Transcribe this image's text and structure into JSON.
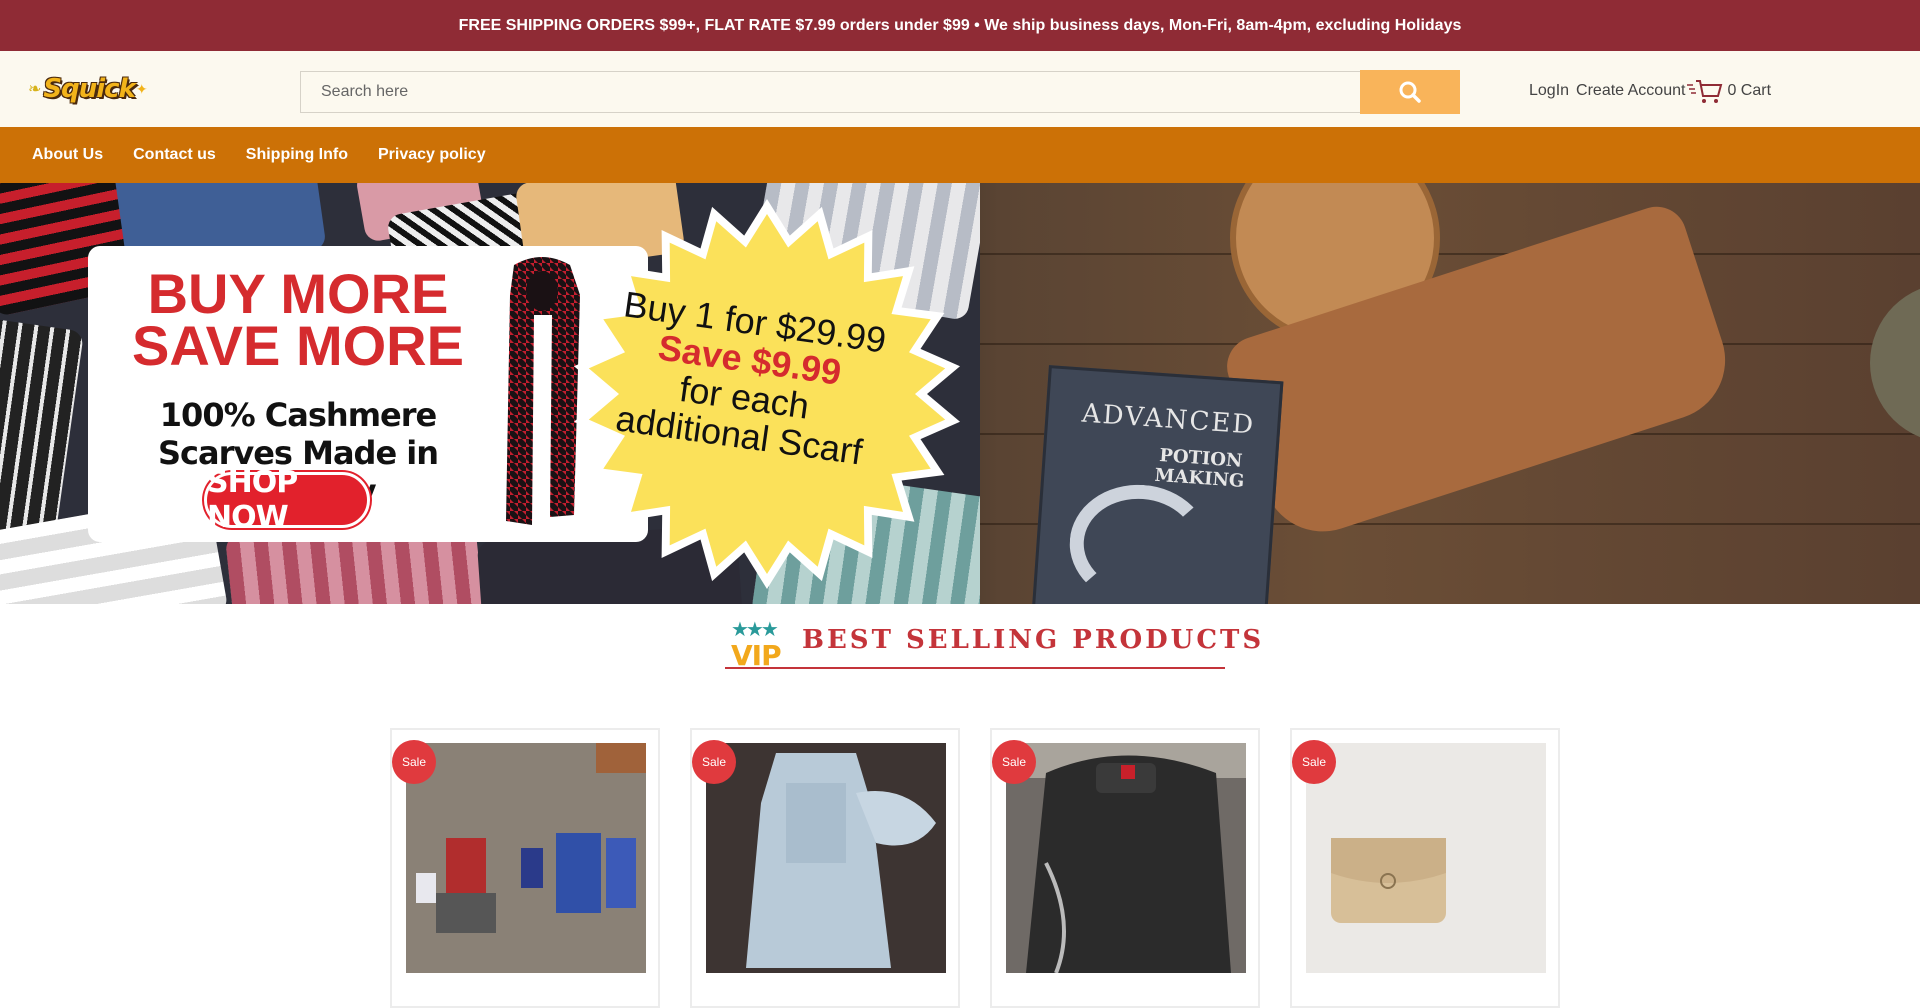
{
  "announcement": "FREE SHIPPING ORDERS $99+, FLAT RATE $7.99 orders under $99 • We ship business days, Mon-Fri, 8am-4pm, excluding Holidays",
  "brand": {
    "logo_text": "Squick",
    "logo_icon": "bee-icon"
  },
  "search": {
    "placeholder": "Search here",
    "button_icon": "search-icon"
  },
  "account": {
    "login": "LogIn",
    "create": "Create Account",
    "cart_icon": "cart-icon",
    "cart_label": "0 Cart"
  },
  "nav": {
    "items": [
      "About Us",
      "Contact us",
      "Shipping Info",
      "Privacy policy"
    ]
  },
  "hero": {
    "headline": "BUY MORE SAVE MORE",
    "sub": "100% Cashmere Scarves Made in Germany",
    "cta": "SHOP NOW",
    "promo_line1": "Buy 1 for $29.99",
    "promo_save": "Save $9.99",
    "promo_line3": "for each additional Scarf",
    "book_title": "ADVANCED",
    "book_sub": "POTION MAKING"
  },
  "section": {
    "badge": "VIP",
    "title": "BEST SELLING PRODUCTS"
  },
  "products": [
    {
      "badge": "Sale",
      "image": "toy-robots-photo"
    },
    {
      "badge": "Sale",
      "image": "christening-gown-photo"
    },
    {
      "badge": "Sale",
      "image": "backpack-photo"
    },
    {
      "badge": "Sale",
      "image": "cardholder-wallet-photo"
    }
  ],
  "colors": {
    "topbar": "#8f2b35",
    "nav": "#cc7106",
    "search_button": "#f9b45a",
    "accent_red": "#c4343a",
    "sale_badge": "#e03a3e"
  }
}
